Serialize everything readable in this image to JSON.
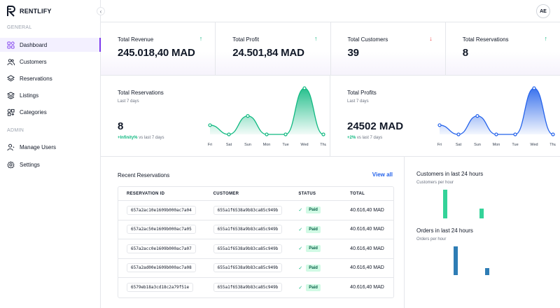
{
  "brand": {
    "name": "RENTLIFY"
  },
  "sidebar": {
    "sections": [
      {
        "label": "GENERAL",
        "items": [
          {
            "label": "Dashboard",
            "icon": "dashboard-icon",
            "active": true
          },
          {
            "label": "Customers",
            "icon": "users-icon"
          },
          {
            "label": "Reservations",
            "icon": "layers-icon"
          },
          {
            "label": "Listings",
            "icon": "stack-icon"
          },
          {
            "label": "Categories",
            "icon": "categories-icon"
          }
        ]
      },
      {
        "label": "ADMIN",
        "items": [
          {
            "label": "Manage Users",
            "icon": "user-manage-icon"
          },
          {
            "label": "Settings",
            "icon": "gear-icon"
          }
        ]
      }
    ]
  },
  "user": {
    "initials": "AE"
  },
  "stats": [
    {
      "label": "Total Revenue",
      "value": "245.018,40 MAD",
      "trend": "up"
    },
    {
      "label": "Total Profit",
      "value": "24.501,84 MAD",
      "trend": "up"
    },
    {
      "label": "Total Customers",
      "value": "39",
      "trend": "down"
    },
    {
      "label": "Total Reservations",
      "value": "8",
      "trend": "up"
    }
  ],
  "charts": {
    "reservations": {
      "title": "Total Reservations",
      "subtitle": "Last 7 days",
      "value": "8",
      "change": "+Infinity%",
      "change_suffix": "vs last 7 days",
      "color": "#10b981",
      "chart_data": {
        "type": "area",
        "categories": [
          "Fri",
          "Sat",
          "Sun",
          "Mon",
          "Tue",
          "Wed",
          "Thu"
        ],
        "values": [
          1,
          0,
          2,
          0,
          0,
          5,
          0
        ]
      }
    },
    "profits": {
      "title": "Total Profits",
      "subtitle": "Last 7 days",
      "value": "24502 MAD",
      "change": "+2%",
      "change_suffix": "vs last 7 days",
      "color": "#2563eb",
      "chart_data": {
        "type": "area",
        "categories": [
          "Fri",
          "Sat",
          "Sun",
          "Mon",
          "Tue",
          "Wed",
          "Thu"
        ],
        "values": [
          1,
          0,
          2,
          0,
          0,
          5,
          0
        ]
      }
    }
  },
  "reservations": {
    "title": "Recent Reservations",
    "view_all": "View all",
    "headers": [
      "RESERVATION ID",
      "CUSTOMER",
      "STATUS",
      "TOTAL"
    ],
    "rows": [
      {
        "id": "657a2ac10e1609b000ac7a04",
        "customer": "655a1f6538a9b83ca85c949b",
        "status": "Paid",
        "total": "40.616,40 MAD"
      },
      {
        "id": "657a2ac50e1609b000ac7a05",
        "customer": "655a1f6538a9b83ca85c949b",
        "status": "Paid",
        "total": "40.616,40 MAD"
      },
      {
        "id": "657a2acc0e1609b000ac7a07",
        "customer": "655a1f6538a9b83ca85c949b",
        "status": "Paid",
        "total": "40.616,40 MAD"
      },
      {
        "id": "657a2ad00e1609b000ac7a08",
        "customer": "655a1f6538a9b83ca85c949b",
        "status": "Paid",
        "total": "40.616,40 MAD"
      },
      {
        "id": "6579eb18a3cd18c2a79f51e",
        "customer": "655a1f6538a9b83ca85c949b",
        "status": "Paid",
        "total": "40.616,40 MAD"
      }
    ]
  },
  "hourly": {
    "customers": {
      "title": "Customers in last 24 hours",
      "subtitle": "Customers per hour",
      "color": "#34d399",
      "chart_data": {
        "type": "bar",
        "values": [
          3,
          1
        ]
      }
    },
    "orders": {
      "title": "Orders in last 24 hours",
      "subtitle": "Orders per hour",
      "color": "#2e7db5",
      "chart_data": {
        "type": "bar",
        "values": [
          4,
          1
        ]
      }
    }
  }
}
